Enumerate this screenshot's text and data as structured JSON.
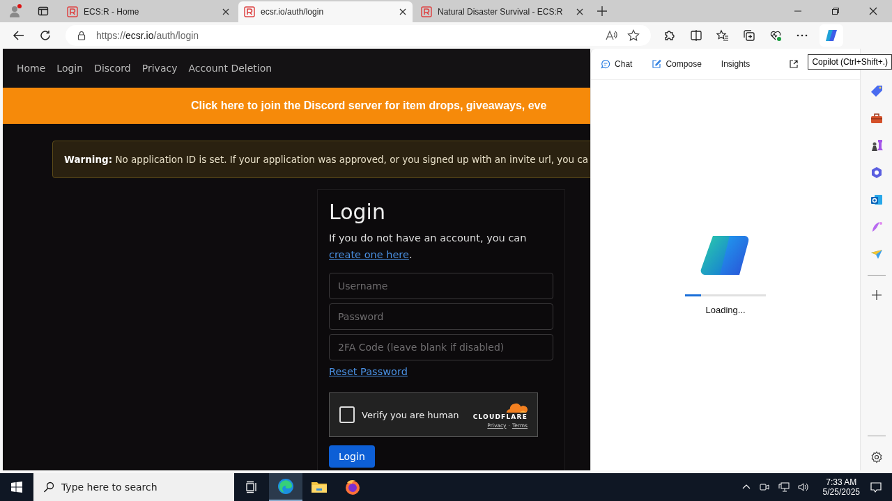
{
  "browser": {
    "tabs": [
      {
        "title": "ECS:R - Home",
        "selected": false
      },
      {
        "title": "ecsr.io/auth/login",
        "selected": true
      },
      {
        "title": "Natural Disaster Survival - ECS:R",
        "selected": false
      }
    ],
    "address": {
      "prefix": "https://",
      "host": "ecsr.io",
      "path": "/auth/login"
    }
  },
  "site": {
    "nav": [
      "Home",
      "Login",
      "Discord",
      "Privacy",
      "Account Deletion"
    ],
    "banner": "Click here to join the Discord server for item drops, giveaways, eve",
    "warning": "**Warning:** No application ID is set. If your application was approved, or you signed up with an invite url, you ca",
    "login": {
      "title": "Login",
      "intro": "If you do not have an account, you can ",
      "intro_link": "create one here",
      "intro_end": ".",
      "fields": [
        {
          "placeholder": "Username"
        },
        {
          "placeholder": "Password"
        },
        {
          "placeholder": "2FA Code (leave blank if disabled)"
        }
      ],
      "reset_link": "Reset Password",
      "captcha": {
        "label": "Verify you are human",
        "checked": false,
        "brand": "CLOUDFLARE",
        "privacy": "Privacy",
        "separator": "·",
        "terms": "Terms"
      },
      "button": "Login"
    }
  },
  "copilot": {
    "tabs": [
      {
        "label": "Chat",
        "selected": false
      },
      {
        "label": "Compose",
        "selected": false
      },
      {
        "label": "Insights",
        "selected": false
      }
    ],
    "tooltip": "Copilot (Ctrl+Shift+.)",
    "loading": {
      "level": 0.2,
      "text": "Loading..."
    }
  },
  "taskbar": {
    "search": {
      "placeholder": "Type here to search"
    },
    "time": "7:33 AM",
    "date": "5/25/2025"
  }
}
